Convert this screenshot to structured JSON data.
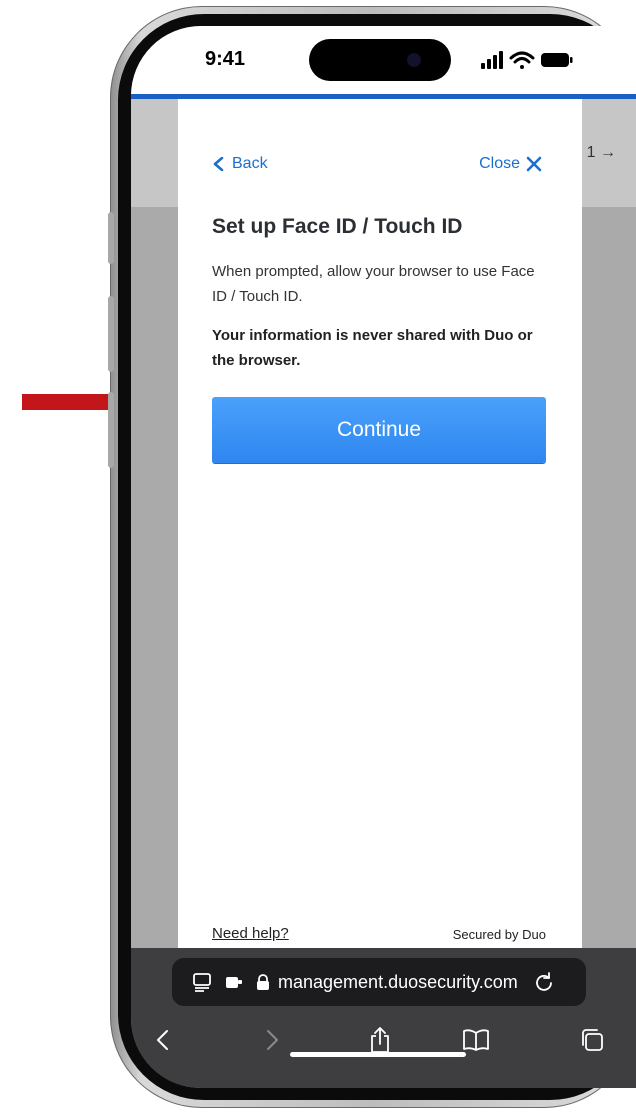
{
  "status_bar": {
    "time": "9:41"
  },
  "background_page": {
    "partial_text": "1 →"
  },
  "modal": {
    "back_label": "Back",
    "close_label": "Close",
    "title": "Set up Face ID / Touch ID",
    "description": "When prompted, allow your browser to use Face ID / Touch ID.",
    "note": "Your information is never shared with Duo or the browser.",
    "continue_label": "Continue",
    "help_label": "Need help?",
    "secured_label": "Secured by Duo"
  },
  "browser": {
    "url": "management.duosecurity.com",
    "icons": [
      "tab-layout-icon",
      "extension-icon",
      "lock-icon",
      "reload-icon",
      "back-icon",
      "forward-icon",
      "share-icon",
      "bookmarks-icon",
      "tabs-icon"
    ]
  },
  "colors": {
    "accent": "#1a5fc4",
    "link": "#1a6fd1",
    "button": "#3a8ff5",
    "annotation_arrow": "#c2161b"
  }
}
